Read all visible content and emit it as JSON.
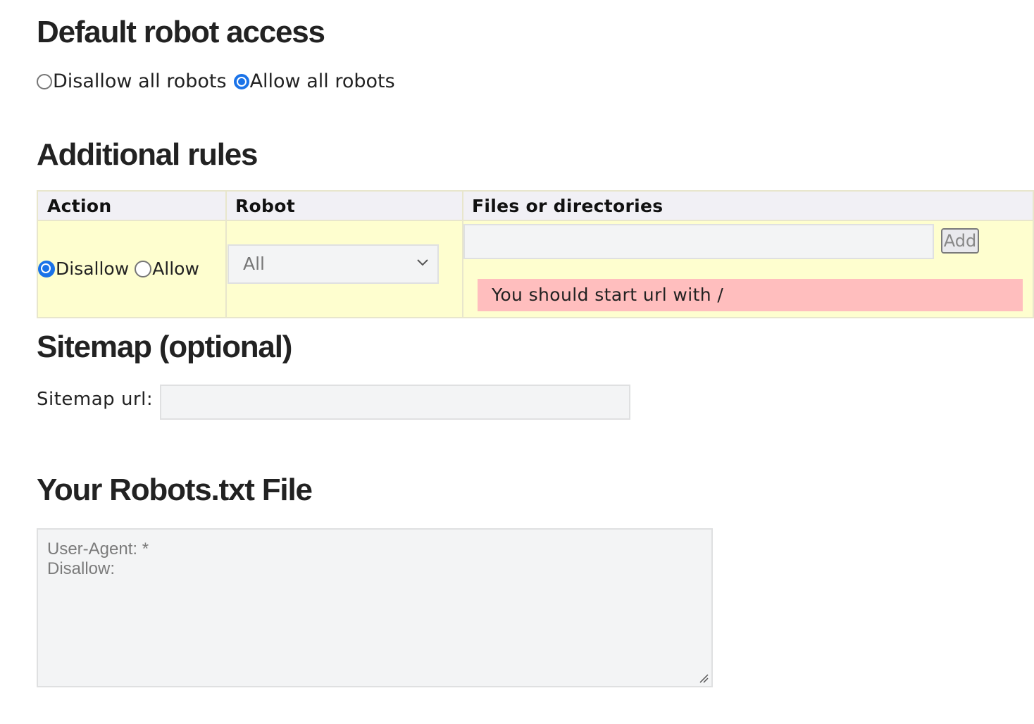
{
  "sections": {
    "default_access": {
      "title": "Default robot access",
      "options": [
        {
          "label": "Disallow all robots",
          "checked": false
        },
        {
          "label": "Allow all robots",
          "checked": true
        }
      ]
    },
    "additional_rules": {
      "title": "Additional rules",
      "headers": {
        "action": "Action",
        "robot": "Robot",
        "files": "Files or directories"
      },
      "action_options": [
        {
          "label": "Disallow",
          "checked": true
        },
        {
          "label": "Allow",
          "checked": false
        }
      ],
      "robot_select": {
        "value": "All",
        "icon": "chevron-down-icon"
      },
      "files_input": {
        "value": "",
        "placeholder": ""
      },
      "add_button": "Add",
      "error_message": "You should start url with /"
    },
    "sitemap": {
      "title": "Sitemap (optional)",
      "label": "Sitemap url:",
      "input": {
        "value": "",
        "placeholder": ""
      }
    },
    "robots_file": {
      "title": "Your Robots.txt File",
      "lines": [
        "User-Agent: *",
        "Disallow:"
      ]
    }
  },
  "colors": {
    "accent": "#1a73e8",
    "rule_row_bg": "#fefecf",
    "header_bg": "#f1f0f5",
    "error_bg": "#ffbebe",
    "input_bg": "#f3f4f5"
  }
}
